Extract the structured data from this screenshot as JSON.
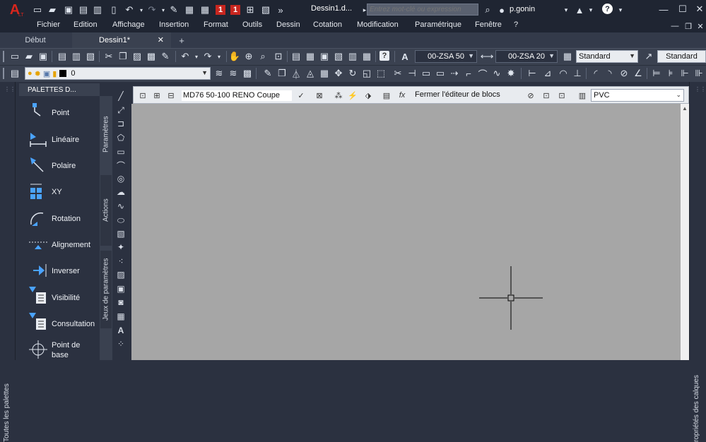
{
  "title_bar": {
    "app_logo": "A",
    "app_logo_sub": "LT",
    "badge_1": "1",
    "badge_2": "1",
    "document_title": "Dessin1.d...",
    "search_placeholder": "Entrez mot-clé ou expression",
    "user_name": "p.gonin"
  },
  "menu": [
    "Fichier",
    "Edition",
    "Affichage",
    "Insertion",
    "Format",
    "Outils",
    "Dessin",
    "Cotation",
    "Modification",
    "Paramétrique",
    "Fenêtre",
    "?"
  ],
  "tabs": [
    {
      "label": "Début",
      "active": false
    },
    {
      "label": "Dessin1*",
      "active": true
    }
  ],
  "toolbar1": {
    "text_style": "00-ZSA 50",
    "dim_style": "00-ZSA 20",
    "table_style": "Standard",
    "mleader_style": "Standard"
  },
  "toolbar2": {
    "layer_value": "0"
  },
  "left_sidebar": {
    "vertical_label": "Toutes les palettes"
  },
  "palettes": {
    "title": "PALETTES D...",
    "items": [
      "Point",
      "Linéaire",
      "Polaire",
      "XY",
      "Rotation",
      "Alignement",
      "Inverser",
      "Visibilité",
      "Consultation",
      "Point de base"
    ],
    "vertical_tabs": [
      "Paramètres",
      "Actions",
      "Jeux de paramètres"
    ]
  },
  "block_editor": {
    "block_name": "MD76 50-100 RENO Coupe",
    "close_label": "Fermer l'éditeur de blocs",
    "visibility_state": "PVC"
  },
  "right_panel": {
    "vertical_label": "ropriétés des calques"
  },
  "colors": {
    "canvas": "#a6a6a6",
    "chrome_dark": "#1f2532",
    "chrome": "#2b3140",
    "toolbar": "#3a4150",
    "accent_red": "#c8261f"
  }
}
